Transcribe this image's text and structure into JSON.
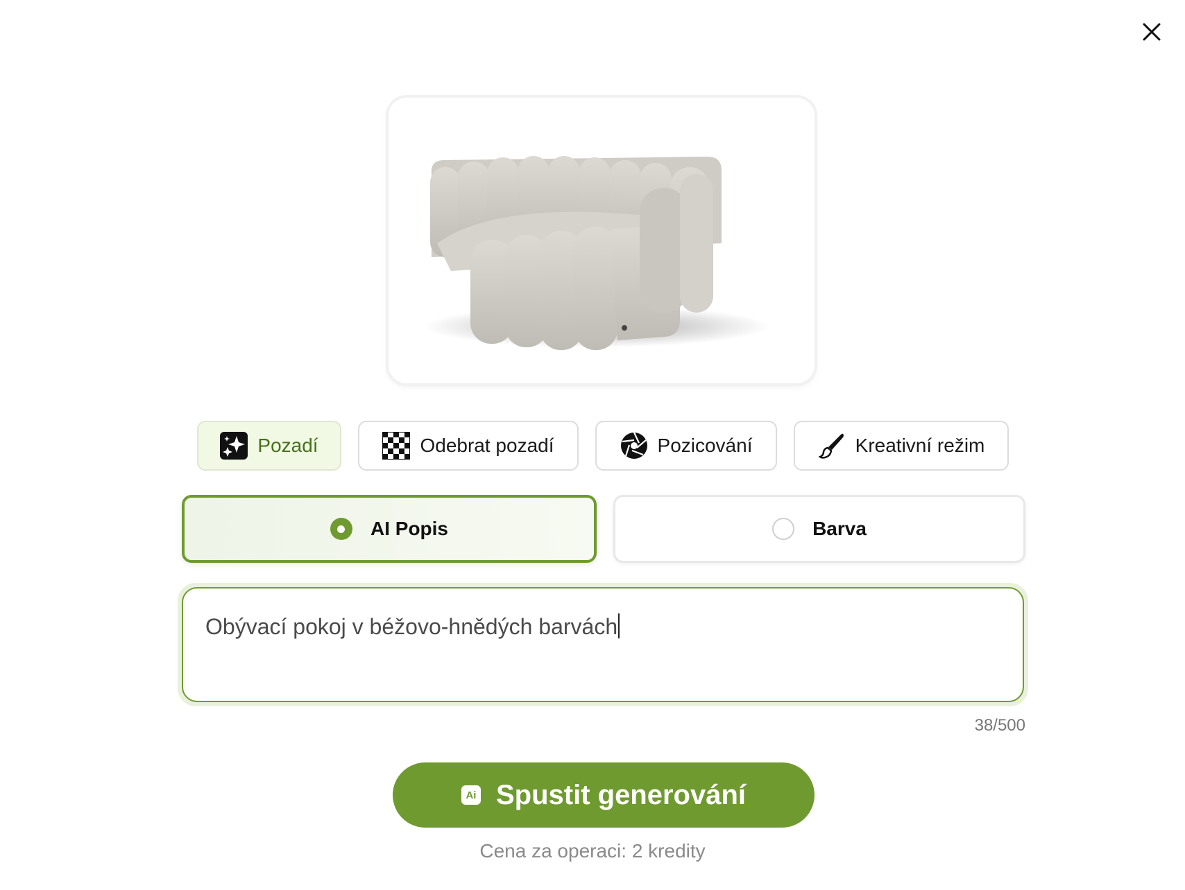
{
  "dialog": {
    "close_label": "close"
  },
  "tools": [
    {
      "label": "Pozadí",
      "icon": "sparkles-icon",
      "active": true
    },
    {
      "label": "Odebrat pozadí",
      "icon": "checkerboard-icon",
      "active": false
    },
    {
      "label": "Pozicování",
      "icon": "aperture-icon",
      "active": false
    },
    {
      "label": "Kreativní režim",
      "icon": "brush-icon",
      "active": false
    }
  ],
  "modes": [
    {
      "label": "AI Popis",
      "selected": true
    },
    {
      "label": "Barva",
      "selected": false
    }
  ],
  "prompt": {
    "value": "Obývací pokoj v béžovo-hnědých barvách",
    "counter": "38/500"
  },
  "generate": {
    "badge": "Ai",
    "label": "Spustit generování"
  },
  "price_note": "Cena za operaci: 2 kredity",
  "colors": {
    "accent": "#6f9a30",
    "active_tab_bg": "#f1f8e4"
  }
}
